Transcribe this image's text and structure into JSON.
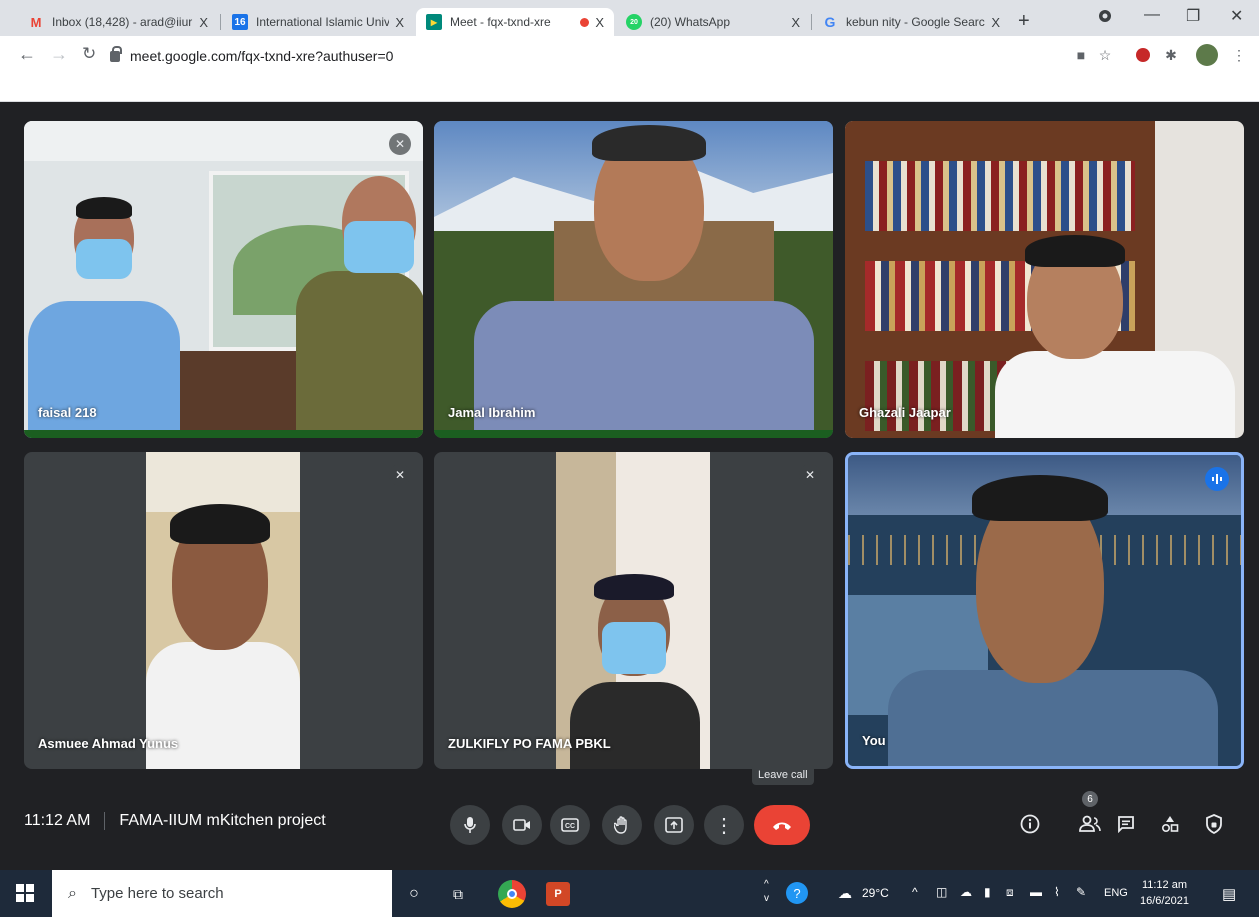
{
  "browser": {
    "tabs": [
      {
        "title": "Inbox (18,428) - arad@iiur",
        "favicon": "gmail-icon",
        "color": "#ea4335",
        "glyph": "M"
      },
      {
        "title": "International Islamic Univ",
        "favicon": "calendar-icon",
        "color": "#1a73e8",
        "glyph": "16"
      },
      {
        "title": "Meet - fqx-txnd-xre",
        "favicon": "meet-icon",
        "color": "#00897b",
        "glyph": "▶",
        "active": true
      },
      {
        "title": "(20) WhatsApp",
        "favicon": "whatsapp-icon",
        "color": "#25d366",
        "glyph": "20"
      },
      {
        "title": "kebun nity - Google Searc",
        "favicon": "google-icon",
        "color": "#4285f4",
        "glyph": "G"
      }
    ],
    "close_glyph": "X",
    "new_tab_glyph": "+",
    "url": "meet.google.com/fqx-txnd-xre?authuser=0"
  },
  "participants": [
    {
      "name": "faisal 218",
      "muted": true
    },
    {
      "name": "Jamal Ibrahim",
      "muted": false
    },
    {
      "name": "Ghazali Jaapar",
      "muted": false
    },
    {
      "name": "Asmuee Ahmad Yunus",
      "muted": true
    },
    {
      "name": "ZULKIFLY PO FAMA PBKL",
      "muted": true
    },
    {
      "name": "You",
      "muted": false,
      "speaking": true
    }
  ],
  "meeting": {
    "time": "11:12 AM",
    "title": "FAMA-IIUM mKitchen project",
    "leave_tooltip": "Leave call",
    "people_count": "6"
  },
  "taskbar": {
    "search_placeholder": "Type here to search",
    "weather": "29°C",
    "language": "ENG",
    "clock_time": "11:12 am",
    "clock_date": "16/6/2021"
  }
}
